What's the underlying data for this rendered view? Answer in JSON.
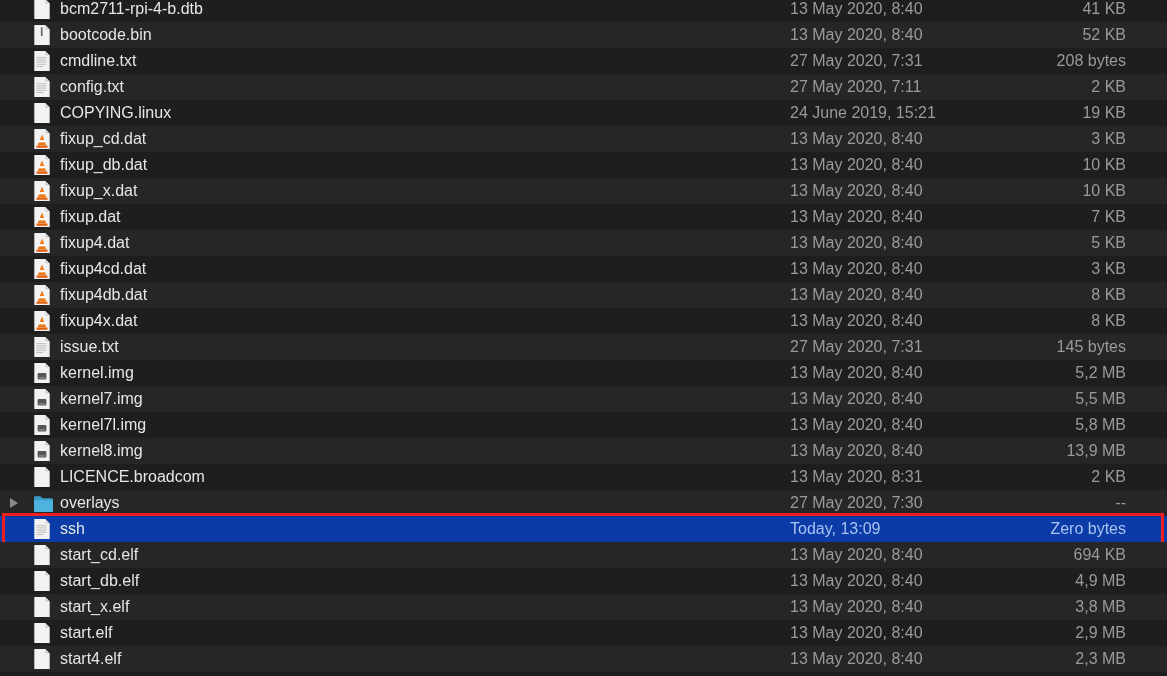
{
  "files": [
    {
      "name": "bcm2711-rpi-4-b.dtb",
      "kind": "document",
      "date": "13 May 2020, 8:40",
      "size": "41 KB",
      "selected": false,
      "highlighted": false
    },
    {
      "name": "bootcode.bin",
      "kind": "binary",
      "date": "13 May 2020, 8:40",
      "size": "52 KB",
      "selected": false,
      "highlighted": false
    },
    {
      "name": "cmdline.txt",
      "kind": "text",
      "date": "27 May 2020, 7:31",
      "size": "208 bytes",
      "selected": false,
      "highlighted": false
    },
    {
      "name": "config.txt",
      "kind": "text",
      "date": "27 May 2020, 7:11",
      "size": "2 KB",
      "selected": false,
      "highlighted": false
    },
    {
      "name": "COPYING.linux",
      "kind": "document",
      "date": "24 June 2019, 15:21",
      "size": "19 KB",
      "selected": false,
      "highlighted": false
    },
    {
      "name": "fixup_cd.dat",
      "kind": "cone",
      "date": "13 May 2020, 8:40",
      "size": "3 KB",
      "selected": false,
      "highlighted": false
    },
    {
      "name": "fixup_db.dat",
      "kind": "cone",
      "date": "13 May 2020, 8:40",
      "size": "10 KB",
      "selected": false,
      "highlighted": false
    },
    {
      "name": "fixup_x.dat",
      "kind": "cone",
      "date": "13 May 2020, 8:40",
      "size": "10 KB",
      "selected": false,
      "highlighted": false
    },
    {
      "name": "fixup.dat",
      "kind": "cone",
      "date": "13 May 2020, 8:40",
      "size": "7 KB",
      "selected": false,
      "highlighted": false
    },
    {
      "name": "fixup4.dat",
      "kind": "cone",
      "date": "13 May 2020, 8:40",
      "size": "5 KB",
      "selected": false,
      "highlighted": false
    },
    {
      "name": "fixup4cd.dat",
      "kind": "cone",
      "date": "13 May 2020, 8:40",
      "size": "3 KB",
      "selected": false,
      "highlighted": false
    },
    {
      "name": "fixup4db.dat",
      "kind": "cone",
      "date": "13 May 2020, 8:40",
      "size": "8 KB",
      "selected": false,
      "highlighted": false
    },
    {
      "name": "fixup4x.dat",
      "kind": "cone",
      "date": "13 May 2020, 8:40",
      "size": "8 KB",
      "selected": false,
      "highlighted": false
    },
    {
      "name": "issue.txt",
      "kind": "text",
      "date": "27 May 2020, 7:31",
      "size": "145 bytes",
      "selected": false,
      "highlighted": false
    },
    {
      "name": "kernel.img",
      "kind": "disk",
      "date": "13 May 2020, 8:40",
      "size": "5,2 MB",
      "selected": false,
      "highlighted": false
    },
    {
      "name": "kernel7.img",
      "kind": "disk",
      "date": "13 May 2020, 8:40",
      "size": "5,5 MB",
      "selected": false,
      "highlighted": false
    },
    {
      "name": "kernel7l.img",
      "kind": "disk",
      "date": "13 May 2020, 8:40",
      "size": "5,8 MB",
      "selected": false,
      "highlighted": false
    },
    {
      "name": "kernel8.img",
      "kind": "disk",
      "date": "13 May 2020, 8:40",
      "size": "13,9 MB",
      "selected": false,
      "highlighted": false
    },
    {
      "name": "LICENCE.broadcom",
      "kind": "document",
      "date": "13 May 2020, 8:31",
      "size": "2 KB",
      "selected": false,
      "highlighted": false
    },
    {
      "name": "overlays",
      "kind": "folder",
      "expanded": false,
      "date": "27 May 2020, 7:30",
      "size": "--",
      "selected": false,
      "highlighted": false
    },
    {
      "name": "ssh",
      "kind": "text",
      "date": "Today, 13:09",
      "size": "Zero bytes",
      "selected": true,
      "highlighted": true
    },
    {
      "name": "start_cd.elf",
      "kind": "document",
      "date": "13 May 2020, 8:40",
      "size": "694 KB",
      "selected": false,
      "highlighted": false
    },
    {
      "name": "start_db.elf",
      "kind": "document",
      "date": "13 May 2020, 8:40",
      "size": "4,9 MB",
      "selected": false,
      "highlighted": false
    },
    {
      "name": "start_x.elf",
      "kind": "document",
      "date": "13 May 2020, 8:40",
      "size": "3,8 MB",
      "selected": false,
      "highlighted": false
    },
    {
      "name": "start.elf",
      "kind": "document",
      "date": "13 May 2020, 8:40",
      "size": "2,9 MB",
      "selected": false,
      "highlighted": false
    },
    {
      "name": "start4.elf",
      "kind": "document",
      "date": "13 May 2020, 8:40",
      "size": "2,3 MB",
      "selected": false,
      "highlighted": false
    }
  ]
}
